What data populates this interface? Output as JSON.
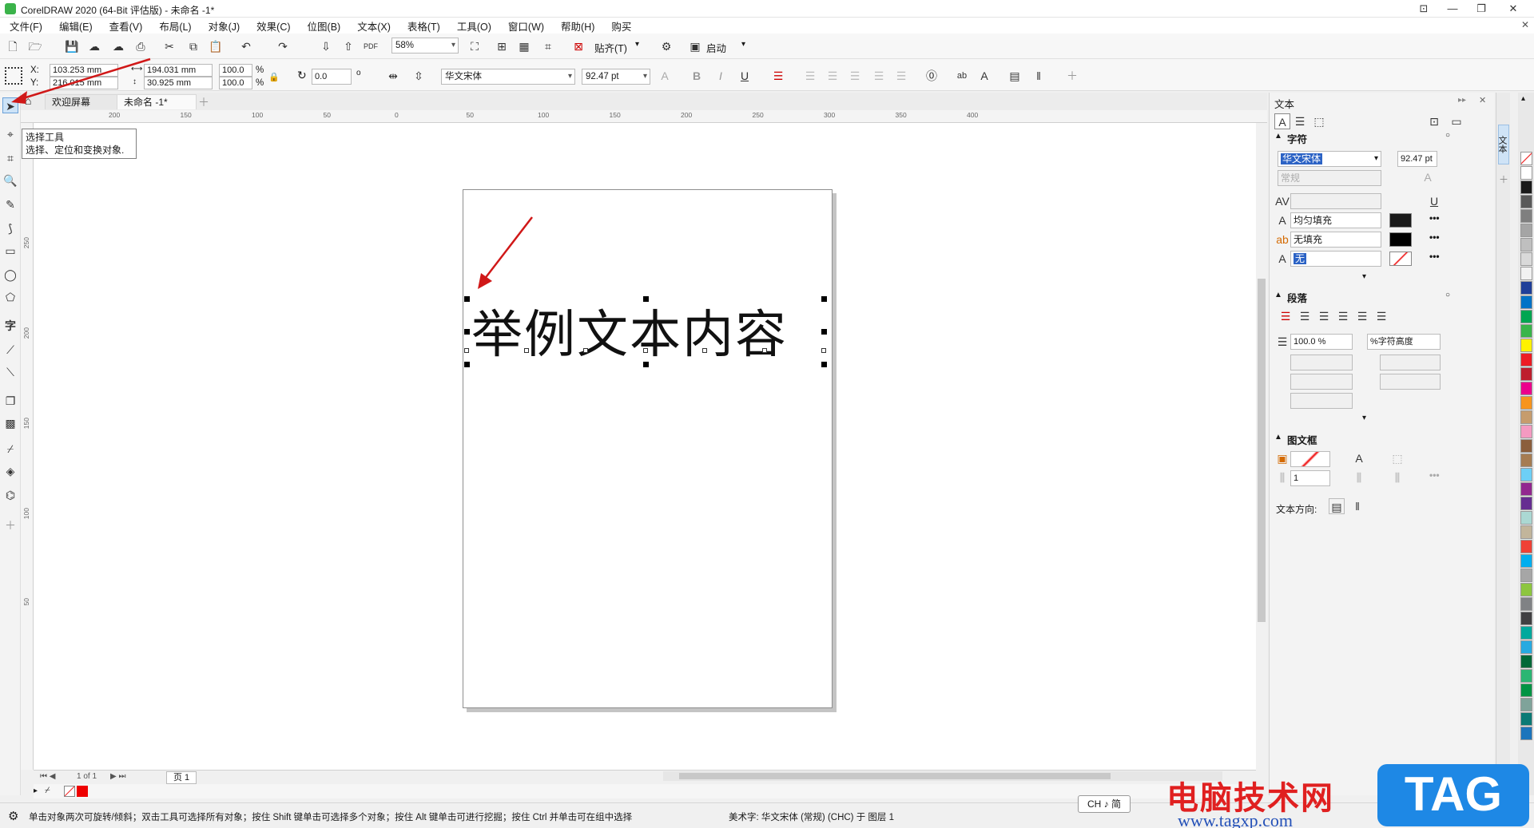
{
  "window": {
    "title": "CorelDRAW 2020 (64-Bit 评估版) - 未命名 -1*"
  },
  "menu": {
    "items": [
      "文件(F)",
      "编辑(E)",
      "查看(V)",
      "布局(L)",
      "对象(J)",
      "效果(C)",
      "位图(B)",
      "文本(X)",
      "表格(T)",
      "工具(O)",
      "窗口(W)",
      "帮助(H)",
      "购买"
    ]
  },
  "toolbar": {
    "zoom": "58%",
    "snap_label": "贴齐(T)",
    "launch_label": "启动"
  },
  "propbar": {
    "x_label": "X:",
    "x_value": "103.253 mm",
    "y_label": "Y:",
    "y_value": "216.015 mm",
    "w_value": "194.031 mm",
    "h_value": "30.925 mm",
    "scale_w": "100.0",
    "scale_h": "100.0",
    "percent": "%",
    "rotation": "0.0",
    "font_name": "华文宋体",
    "font_size": "92.47 pt"
  },
  "tabs": {
    "welcome": "欢迎屏幕",
    "document": "未命名 -1*"
  },
  "tooltip": {
    "title": "选择工具",
    "desc": "选择、定位和变换对象."
  },
  "canvas": {
    "text": "举例文本内容"
  },
  "rulers": {
    "h_labels": [
      "200",
      "150",
      "100",
      "50",
      "0",
      "50",
      "100",
      "150",
      "200",
      "250",
      "300",
      "350",
      "400"
    ],
    "v_labels": [
      "300",
      "250",
      "200",
      "150",
      "100",
      "50"
    ]
  },
  "pagenav": {
    "page_count": "1 of 1",
    "page_tab": "页 1"
  },
  "docker": {
    "title": "文本",
    "char_section": "字符",
    "font": "华文宋体",
    "font_size": "92.47 pt",
    "font_style": "常规",
    "fill_uniform": "均匀填充",
    "fill_none": "无填充",
    "outline": "无",
    "para_section": "段落",
    "line_spacing": "100.0 %",
    "line_spacing_unit": "%字符高度",
    "frame_section": "图文框",
    "frame_cols": "1",
    "text_direction_label": "文本方向:",
    "colors": {
      "fill": "#1a1a1a",
      "background": "#000000",
      "outline": "#ff0000"
    }
  },
  "status": {
    "hint": "单击对象两次可旋转/倾斜；双击工具可选择所有对象；按住 Shift 键单击可选择多个对象；按住 Alt 键单击可进行挖掘；按住 Ctrl 并单击可在组中选择",
    "object_info": "美术字: 华文宋体 (常规) (CHC) 于 图层 1",
    "ime": "CH ♪ 简"
  },
  "watermark": {
    "text1": "电脑技术网",
    "text2": "www.tagxp.com",
    "badge": "TAG"
  },
  "palette": [
    "#ffffff",
    "#1a1a1a",
    "#595959",
    "#7f7f7f",
    "#a5a5a5",
    "#bfbfbf",
    "#d9d9d9",
    "#f2f2f2",
    "#1f3f99",
    "#0073c7",
    "#00a651",
    "#39b54a",
    "#fff200",
    "#ed1c24",
    "#be1e2d",
    "#ec008c",
    "#f7941d",
    "#c69c6d",
    "#f49ac1",
    "#8b5e3c",
    "#a67c52",
    "#6dcff6",
    "#92278f",
    "#662d91",
    "#abd8d3",
    "#c2b59b",
    "#ef4136",
    "#00aeef",
    "#a6a6a6",
    "#8dc63f",
    "#808285",
    "#414042",
    "#00a99d",
    "#27aae1",
    "#006838",
    "#2bb673",
    "#009444",
    "#7fa39a",
    "#0b7a75",
    "#1c75bc"
  ]
}
